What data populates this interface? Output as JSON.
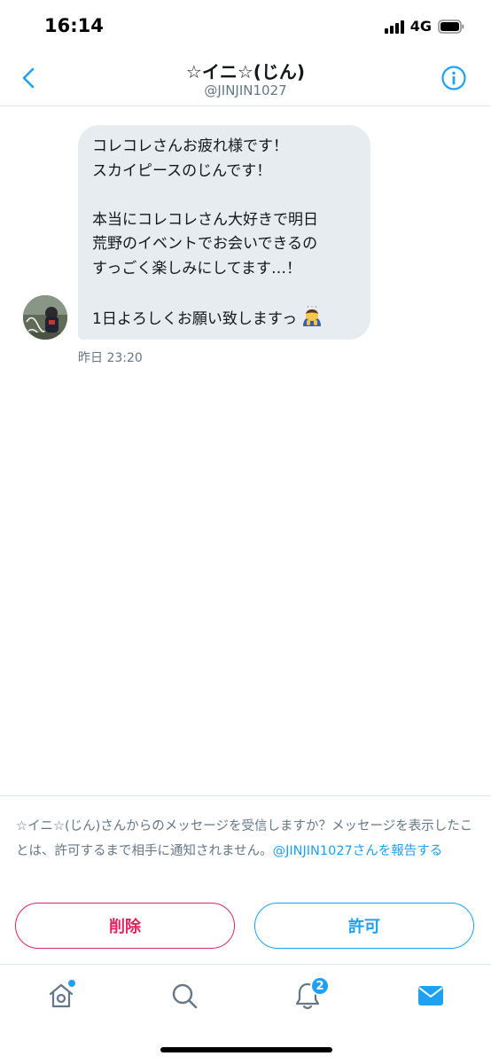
{
  "status_bar": {
    "time": "16:14",
    "network": "4G"
  },
  "header": {
    "title": "☆イニ☆(じん)",
    "handle": "@JINJIN1027"
  },
  "message": {
    "lines": [
      "コレコレさんお疲れ様です！",
      "スカイピースのじんです！",
      "",
      "本当にコレコレさん大好きで明日",
      "荒野のイベントでお会いできるの",
      "すっごく楽しみにしてます…！",
      "",
      "1日よろしくお願い致しますっ"
    ],
    "emoji": "bowing-person-emoji",
    "timestamp": "昨日 23:20"
  },
  "request": {
    "text": "☆イニ☆(じん)さんからのメッセージを受信しますか？メッセージを表示したことは、許可するまで相手に通知されません。",
    "report_link": "@JINJIN1027さんを報告する",
    "delete_label": "削除",
    "allow_label": "許可"
  },
  "tab_bar": {
    "notification_count": "2"
  },
  "colors": {
    "accent": "#1da1f2",
    "danger": "#e0245e",
    "bubble": "#e6ecf0",
    "secondary_text": "#657786"
  }
}
